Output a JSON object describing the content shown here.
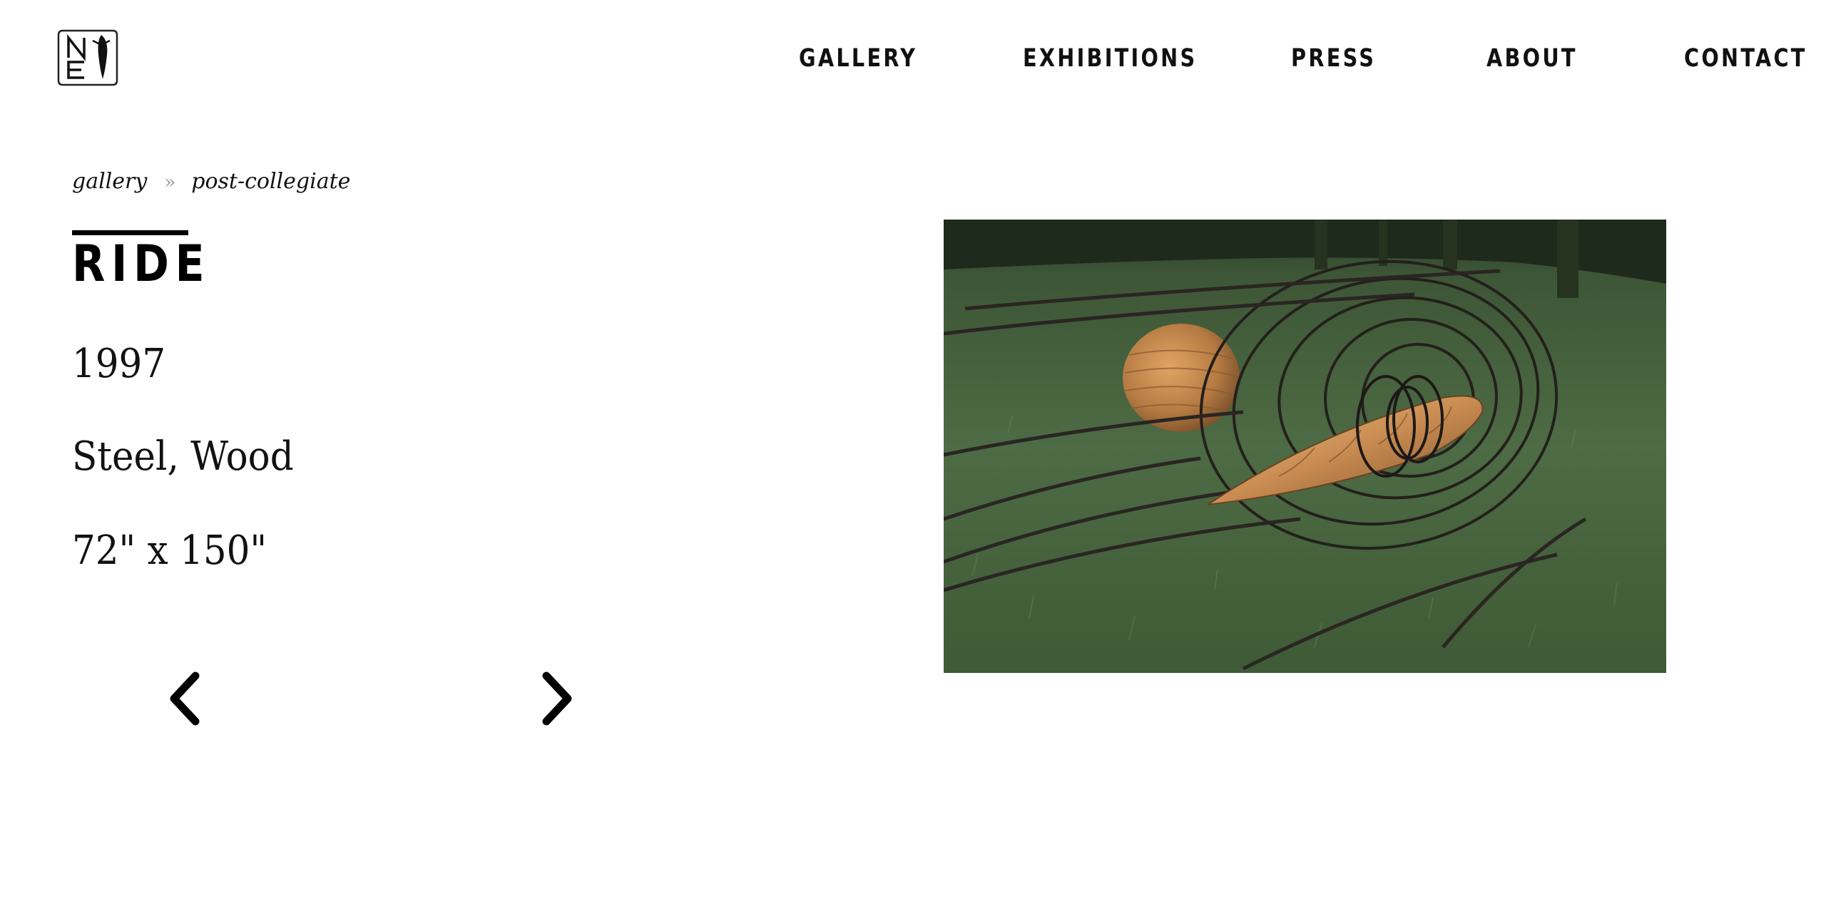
{
  "brand": {
    "logo_icon": "ne-monogram-logo",
    "logo_text": "NE"
  },
  "nav": {
    "items": [
      {
        "label": "GALLERY"
      },
      {
        "label": "EXHIBITIONS"
      },
      {
        "label": "PRESS"
      },
      {
        "label": "ABOUT"
      },
      {
        "label": "CONTACT"
      }
    ]
  },
  "breadcrumb": {
    "items": [
      {
        "label": "gallery"
      },
      {
        "label": "post-collegiate"
      }
    ],
    "separator": "»"
  },
  "artwork": {
    "title": "RIDE",
    "year": "1997",
    "medium": "Steel, Wood",
    "dimensions": "72\" x 150\""
  },
  "pagination": {
    "prev_icon": "chevron-left-icon",
    "next_icon": "chevron-right-icon"
  },
  "colors": {
    "text": "#000000",
    "separator": "#9a9a9a",
    "background": "#ffffff"
  }
}
